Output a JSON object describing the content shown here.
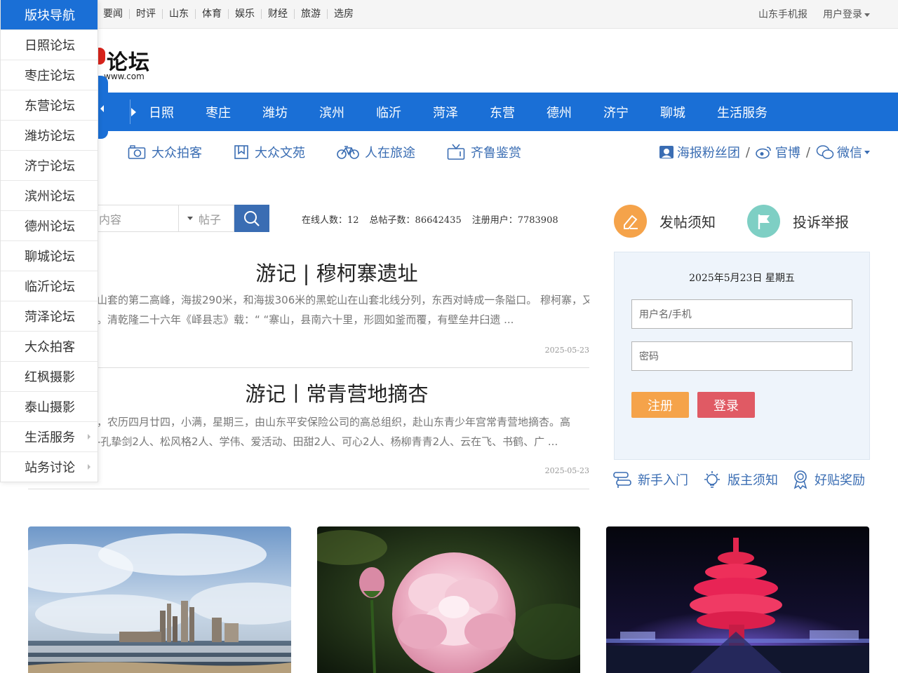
{
  "top_nav": [
    "要闻",
    "时评",
    "山东",
    "体育",
    "娱乐",
    "财经",
    "旅游",
    "选房"
  ],
  "top_right": {
    "mobile": "山东手机报",
    "login": "用户登录"
  },
  "logo": {
    "name": "论坛",
    "url": "www.com"
  },
  "side_menu": {
    "header": "版块导航",
    "items": [
      "日照论坛",
      "枣庄论坛",
      "东营论坛",
      "潍坊论坛",
      "济宁论坛",
      "滨州论坛",
      "德州论坛",
      "聊城论坛",
      "临沂论坛",
      "菏泽论坛",
      "大众拍客",
      "红枫摄影",
      "泰山摄影",
      "生活服务",
      "站务讨论"
    ]
  },
  "city_nav": [
    "日照",
    "枣庄",
    "潍坊",
    "滨州",
    "临沂",
    "菏泽",
    "东营",
    "德州",
    "济宁",
    "聊城",
    "生活服务"
  ],
  "sub_nav": [
    {
      "label": "大众拍客",
      "icon": "camera-icon"
    },
    {
      "label": "大众文苑",
      "icon": "bookmark-icon"
    },
    {
      "label": "人在旅途",
      "icon": "bicycle-icon"
    },
    {
      "label": "齐鲁鉴赏",
      "icon": "tv-icon"
    }
  ],
  "social": {
    "poster": "海报粉丝团",
    "weibo": "官博",
    "wechat": "微信",
    "slash": "/"
  },
  "search": {
    "placeholder": "内容",
    "type": "帖子"
  },
  "stats": {
    "online": "在线人数：12",
    "posts": "总帖子数：86642435",
    "users": "注册用户：7783908"
  },
  "articles": [
    {
      "title": "游记 | 穆柯寨遗址",
      "line1": "山套的第二高峰，海拔290米，和海拔306米的黑蛇山在山套北线分列，东西对峙成一条隘口。 穆柯寨，又名",
      "line2": "。清乾隆二十六年《峄县志》载：“ “寨山，县南六十里，形圆如釜而覆，有壁垒井臼遗 ...",
      "date": "2025-05-23"
    },
    {
      "title": "游记丨常青营地摘杏",
      "line1": "，农历四月廿四，小满，星期三，由山东平安保险公司的高总组织，赴山东青少年宫常青营地摘杏。高",
      "line2": "-孔挚剑2人、松风格2人、学伟、爱活动、田甜2人、可心2人、杨柳青青2人、云在飞、书鹤、广 ...",
      "date": "2025-05-23"
    }
  ],
  "actions": {
    "post_rules": "发帖须知",
    "report": "投诉举报"
  },
  "login_box": {
    "date": "2025年5月23日 星期五",
    "username_placeholder": "用户名/手机",
    "password_placeholder": "密码",
    "register": "注册",
    "login": "登录"
  },
  "links": {
    "newbie": "新手入门",
    "moderator": "版主须知",
    "reward": "好贴奖励"
  },
  "colors": {
    "primary": "#1a6fd6",
    "link": "#3a6db3",
    "orange": "#f5a34a",
    "red": "#e05a64",
    "teal": "#7ecfc4"
  }
}
